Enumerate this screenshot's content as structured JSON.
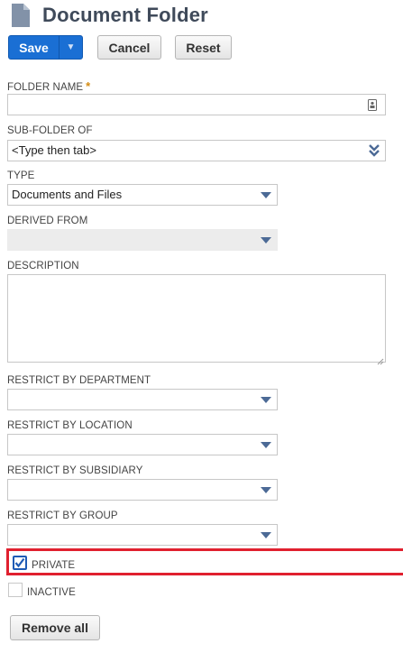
{
  "header": {
    "title": "Document Folder",
    "icon": "document-icon"
  },
  "toolbar": {
    "save_label": "Save",
    "cancel_label": "Cancel",
    "reset_label": "Reset"
  },
  "fields": {
    "folder_name": {
      "label": "FOLDER NAME",
      "required_marker": "*",
      "value": ""
    },
    "sub_folder_of": {
      "label": "SUB-FOLDER OF",
      "value": "<Type then tab>"
    },
    "type": {
      "label": "TYPE",
      "value": "Documents and Files"
    },
    "derived_from": {
      "label": "DERIVED FROM",
      "value": ""
    },
    "description": {
      "label": "DESCRIPTION",
      "value": ""
    },
    "restrict_department": {
      "label": "RESTRICT BY DEPARTMENT",
      "value": ""
    },
    "restrict_location": {
      "label": "RESTRICT BY LOCATION",
      "value": ""
    },
    "restrict_subsidiary": {
      "label": "RESTRICT BY SUBSIDIARY",
      "value": ""
    },
    "restrict_group": {
      "label": "RESTRICT BY GROUP",
      "value": ""
    }
  },
  "checkboxes": {
    "private": {
      "label": "PRIVATE",
      "checked": true
    },
    "inactive": {
      "label": "INACTIVE",
      "checked": false
    }
  },
  "footer": {
    "remove_all_label": "Remove all"
  },
  "colors": {
    "primary": "#1a6fd4",
    "highlight": "#e0202f",
    "required": "#d48b12"
  }
}
